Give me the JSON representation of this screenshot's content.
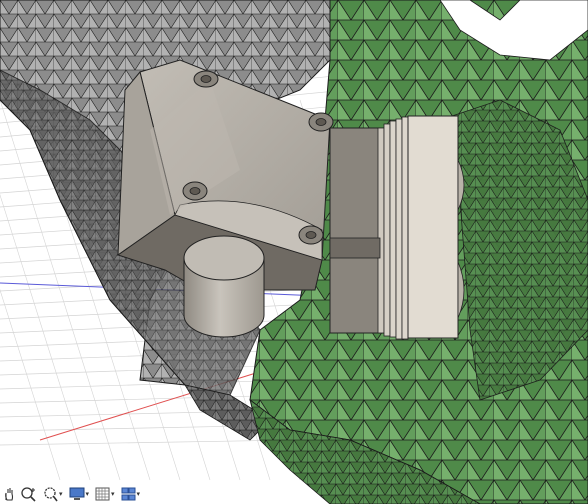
{
  "viewport": {
    "colors": {
      "background": "#ffffff",
      "grid_line": "#d4d4d4",
      "axis_x": "#e05050",
      "axis_y": "#5a5ad8",
      "mesh_gray_fill": "#9c9c9c",
      "mesh_green_fill": "#5f9a58",
      "mesh_edge": "#1c1c1c",
      "part_body": "#b3aea6",
      "part_shadow": "#7f7a72",
      "part_highlight": "#d8d3cb",
      "fins": "#dcd6cc"
    }
  },
  "toolbar": {
    "buttons": [
      {
        "icon": "pan-hand-icon",
        "has_menu": false
      },
      {
        "icon": "zoom-icon",
        "has_menu": false
      },
      {
        "icon": "zoom-window-icon",
        "has_menu": true
      },
      {
        "icon": "display-settings-icon",
        "has_menu": true
      },
      {
        "icon": "grid-snap-icon",
        "has_menu": true
      },
      {
        "icon": "viewports-icon",
        "has_menu": true
      }
    ],
    "menu_caret": "▾"
  }
}
